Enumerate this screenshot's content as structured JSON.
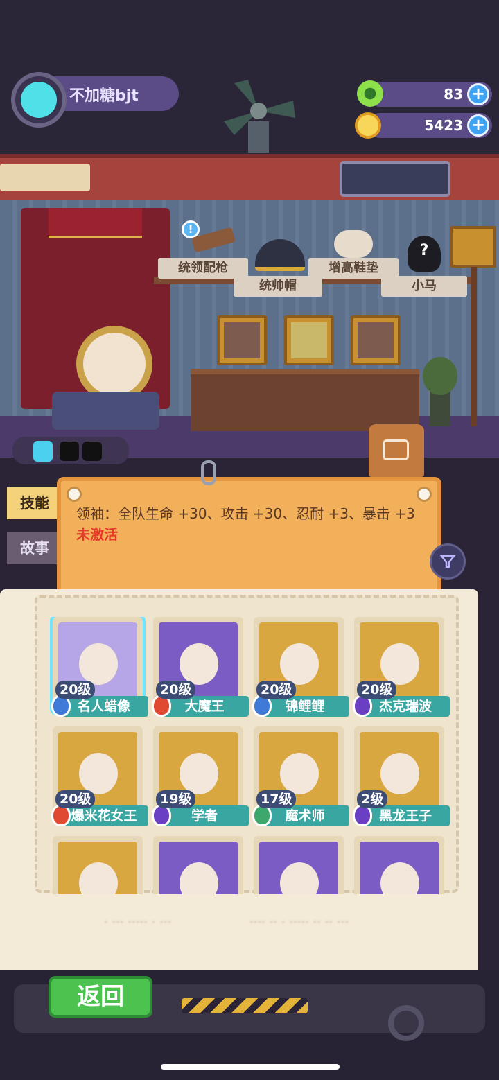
{
  "player": {
    "name": "不加糖bjt"
  },
  "resources": [
    {
      "icon": "green-gem-icon",
      "value": "83"
    },
    {
      "icon": "gold-coin-icon",
      "value": "5423"
    }
  ],
  "room_items": {
    "row1": [
      "统领配枪",
      "增高鞋垫"
    ],
    "row2": [
      "统帅帽",
      "小马"
    ]
  },
  "side_tabs": [
    {
      "label": "技能",
      "active": true
    },
    {
      "label": "故事",
      "active": false
    }
  ],
  "skill": {
    "text": "领袖：全队生命 +30、攻击 +30、忍耐 +3、暴击 +3 ",
    "status": "未激活"
  },
  "characters": [
    {
      "name": "名人蜡像",
      "level": "20级",
      "shield_color": "#3f7ad8",
      "art": "#b6a6e8",
      "selected": true
    },
    {
      "name": "大魔王",
      "level": "20级",
      "shield_color": "#e04a32",
      "art": "#7b5cc4"
    },
    {
      "name": "锦鲤鲤",
      "level": "20级",
      "shield_color": "#3f7ad8",
      "art": "#d8a73f"
    },
    {
      "name": "杰克瑞波",
      "level": "20级",
      "shield_color": "#6a3fc4",
      "art": "#d8a73f"
    },
    {
      "name": "爆米花女王",
      "level": "20级",
      "shield_color": "#e04a32",
      "art": "#d8a73f"
    },
    {
      "name": "学者",
      "level": "19级",
      "shield_color": "#6a3fc4",
      "art": "#d8a73f"
    },
    {
      "name": "魔术师",
      "level": "17级",
      "shield_color": "#3ca86c",
      "art": "#d8a73f"
    },
    {
      "name": "黑龙王子",
      "level": "2级",
      "shield_color": "#6a3fc4",
      "art": "#d8a73f"
    },
    {
      "name": "",
      "level": "",
      "shield_color": "",
      "art": "#d8a73f"
    },
    {
      "name": "",
      "level": "",
      "shield_color": "",
      "art": "#7b5cc4"
    },
    {
      "name": "",
      "level": "",
      "shield_color": "",
      "art": "#7b5cc4"
    },
    {
      "name": "",
      "level": "",
      "shield_color": "",
      "art": "#7b5cc4"
    }
  ],
  "back_button": "返回"
}
